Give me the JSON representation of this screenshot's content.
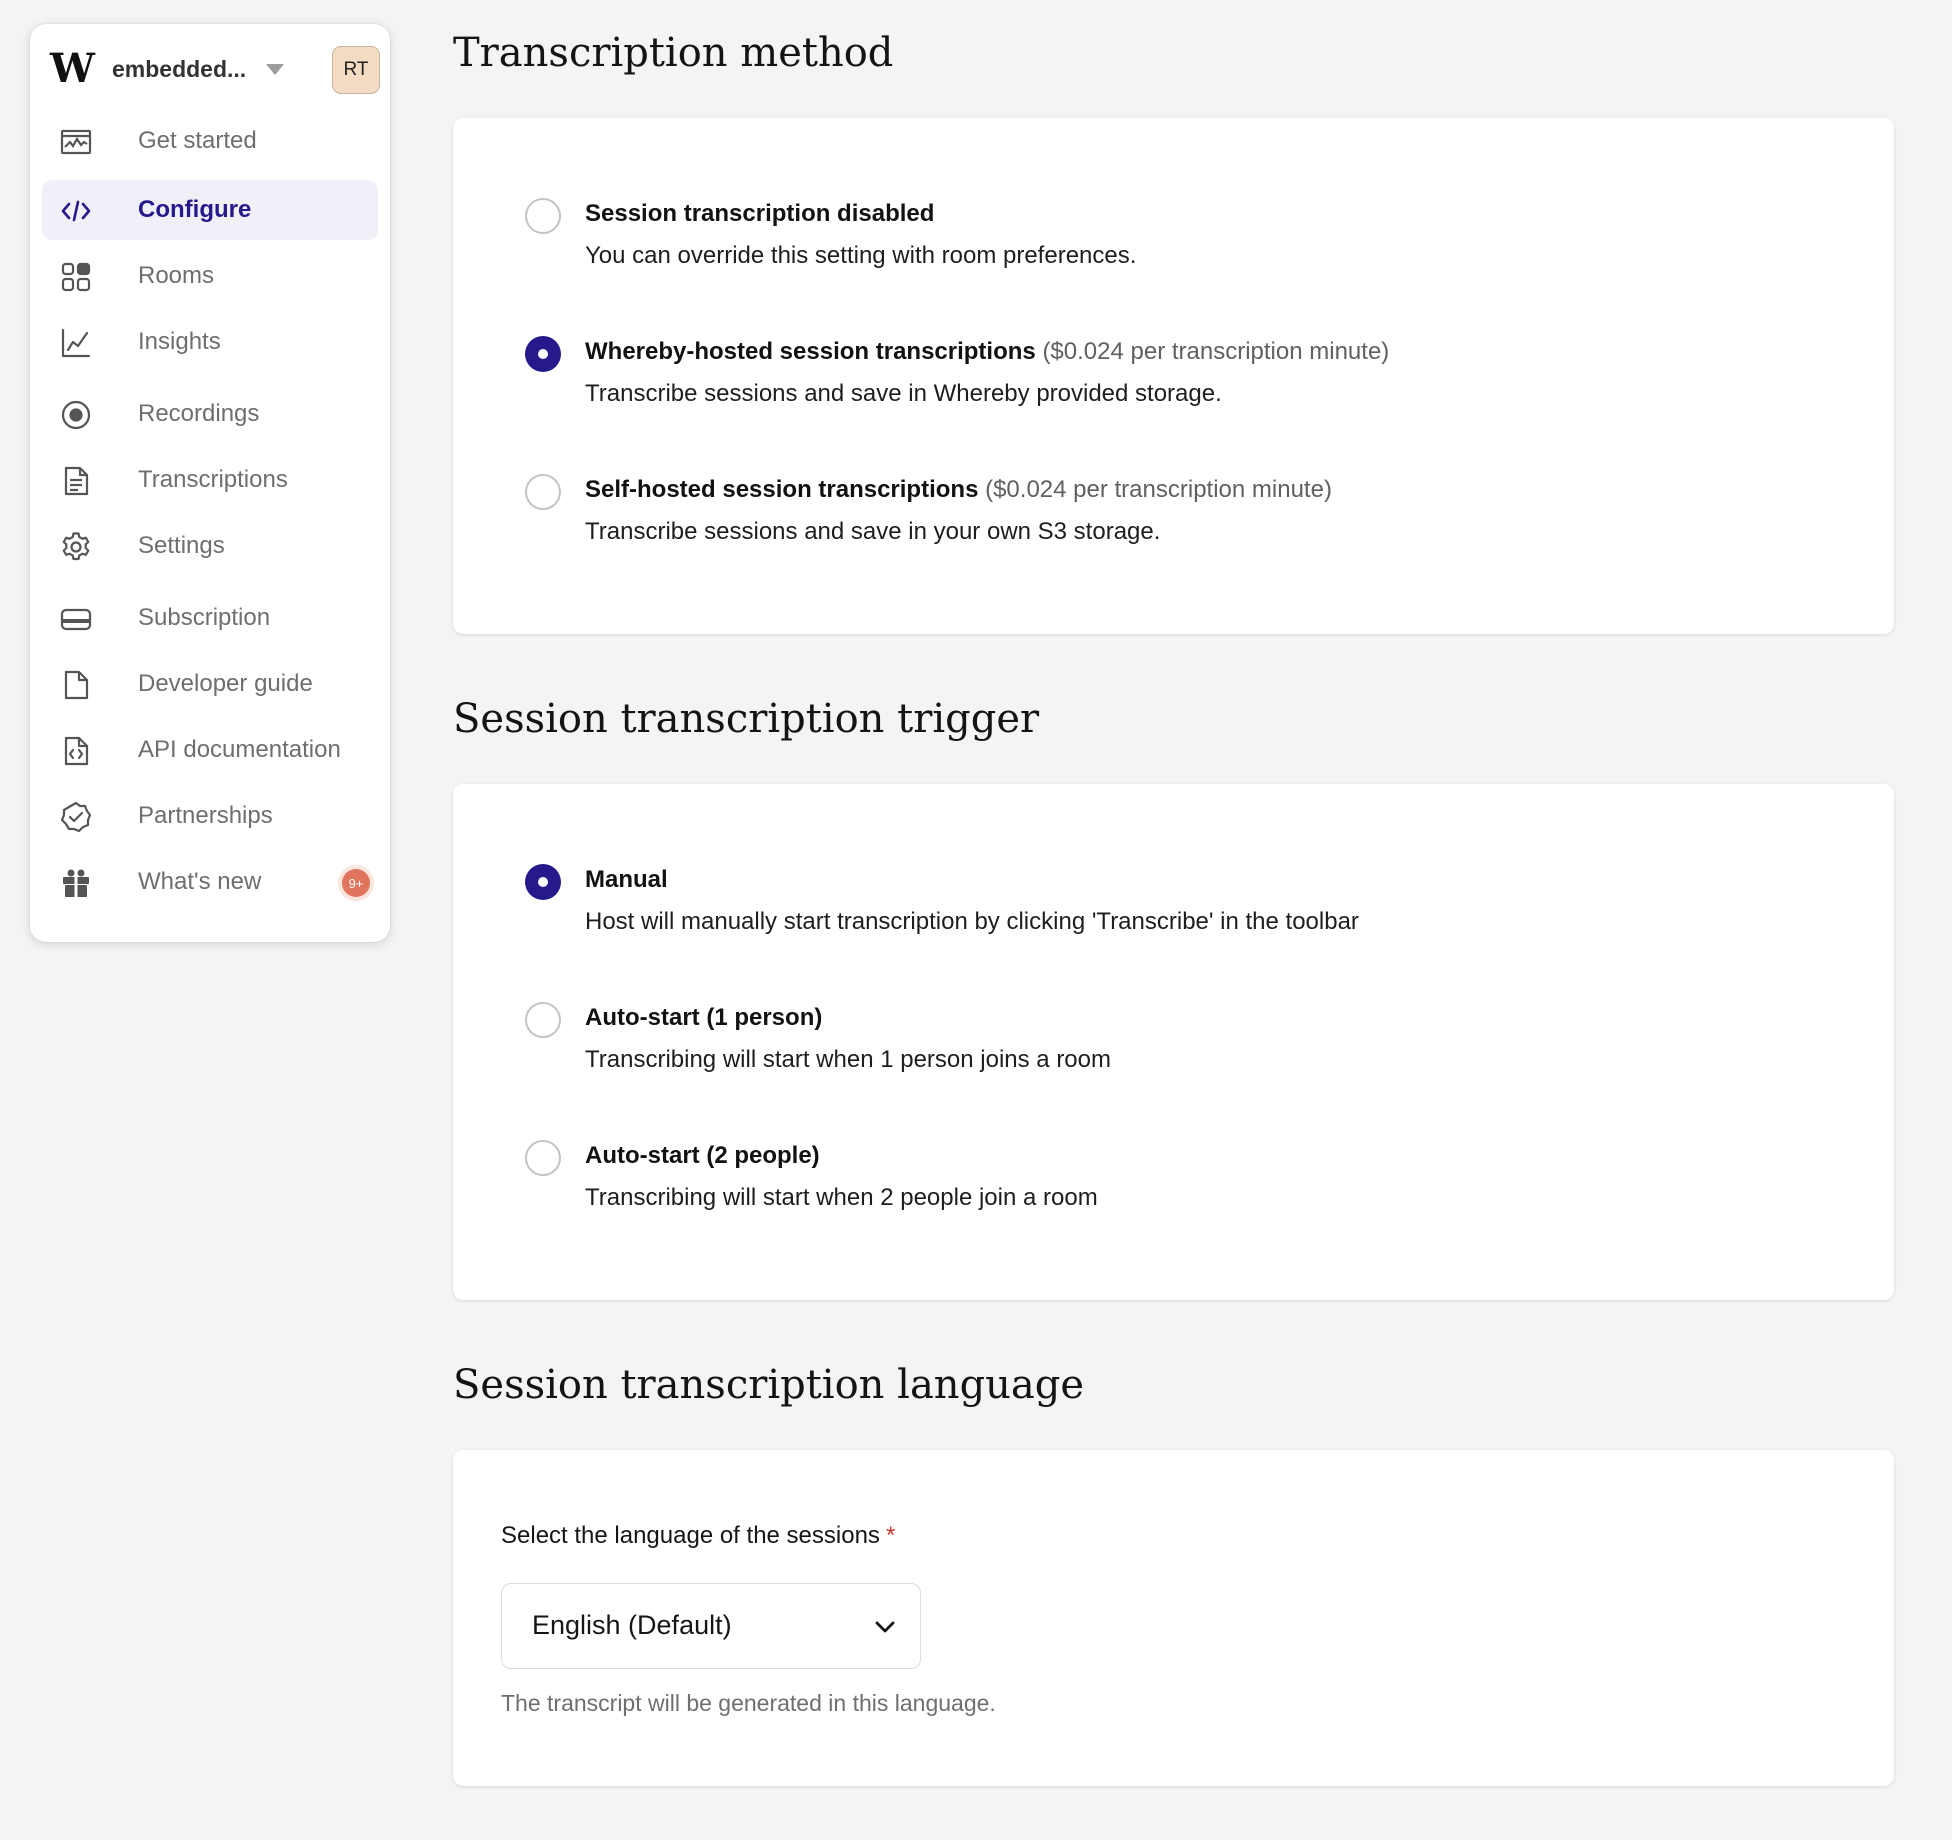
{
  "sidebar": {
    "logo": "W",
    "org_name": "embedded...",
    "avatar_initials": "RT",
    "items": [
      {
        "label": "Get started",
        "icon": "chart-icon"
      },
      {
        "label": "Configure",
        "icon": "code-icon",
        "active": true
      },
      {
        "label": "Rooms",
        "icon": "grid-icon"
      },
      {
        "label": "Insights",
        "icon": "line-chart-icon"
      },
      {
        "label": "Recordings",
        "icon": "record-icon"
      },
      {
        "label": "Transcriptions",
        "icon": "document-icon"
      },
      {
        "label": "Settings",
        "icon": "gear-icon"
      },
      {
        "label": "Subscription",
        "icon": "credit-card-icon"
      },
      {
        "label": "Developer guide",
        "icon": "file-icon"
      },
      {
        "label": "API documentation",
        "icon": "code-file-icon"
      },
      {
        "label": "Partnerships",
        "icon": "verified-badge-icon"
      },
      {
        "label": "What's new",
        "icon": "gift-icon",
        "badge": "9+"
      }
    ],
    "accent_color": "#25198c",
    "badge_color": "#e0745d"
  },
  "sections": {
    "method": {
      "title": "Transcription method",
      "options": [
        {
          "title": "Session transcription disabled",
          "price": "",
          "desc": "You can override this setting with room preferences.",
          "checked": false
        },
        {
          "title": "Whereby-hosted session transcriptions",
          "price": "($0.024 per transcription minute)",
          "desc": "Transcribe sessions and save in Whereby provided storage.",
          "checked": true
        },
        {
          "title": "Self-hosted session transcriptions",
          "price": "($0.024 per transcription minute)",
          "desc": "Transcribe sessions and save in your own S3 storage.",
          "checked": false
        }
      ]
    },
    "trigger": {
      "title": "Session transcription trigger",
      "options": [
        {
          "title": "Manual",
          "desc": "Host will manually start transcription by clicking 'Transcribe' in the toolbar",
          "checked": true
        },
        {
          "title": "Auto-start (1 person)",
          "desc": "Transcribing will start when 1 person joins a room",
          "checked": false
        },
        {
          "title": "Auto-start (2 people)",
          "desc": "Transcribing will start when 2 people join a room",
          "checked": false
        }
      ]
    },
    "language": {
      "title": "Session transcription language",
      "label": "Select the language of the sessions",
      "required_mark": "*",
      "selected": "English (Default)",
      "hint": "The transcript will be generated in this language."
    }
  }
}
